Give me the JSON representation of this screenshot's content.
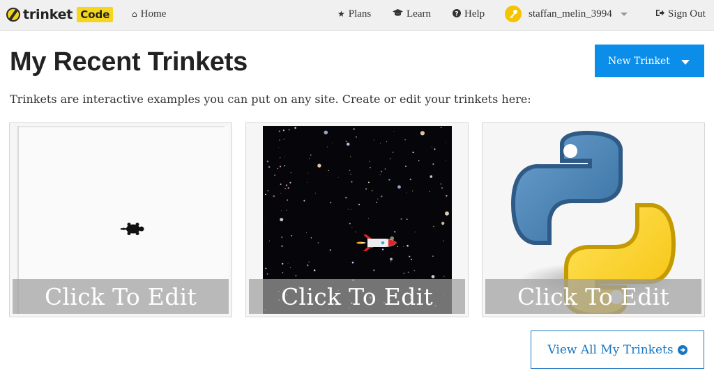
{
  "nav": {
    "brand": "trinket",
    "brand_badge": "Code",
    "home": "Home",
    "plans": "Plans",
    "learn": "Learn",
    "help": "Help",
    "username": "staffan_melin_3994",
    "sign_out": "Sign Out",
    "icons": {
      "home": "home-icon",
      "plans": "star-icon",
      "learn": "graduation-cap-icon",
      "help": "question-circle-icon",
      "avatar": "key-icon",
      "sign_out": "sign-out-icon"
    }
  },
  "main": {
    "title": "My Recent Trinkets",
    "new_button": "New Trinket",
    "intro": "Trinkets are interactive examples you can put on any site. Create or edit your trinkets here:",
    "cards": [
      {
        "overlay": "Click To Edit",
        "thumbnail": "turtle-canvas"
      },
      {
        "overlay": "Click To Edit",
        "thumbnail": "space-rocket"
      },
      {
        "overlay": "Click To Edit",
        "thumbnail": "python-logo"
      }
    ],
    "view_all": "View All My Trinkets"
  },
  "colors": {
    "accent_blue": "#0b8eea",
    "link_blue": "#1976c2",
    "brand_yellow": "#f5d61c",
    "nav_bg": "#f0f0f0"
  }
}
